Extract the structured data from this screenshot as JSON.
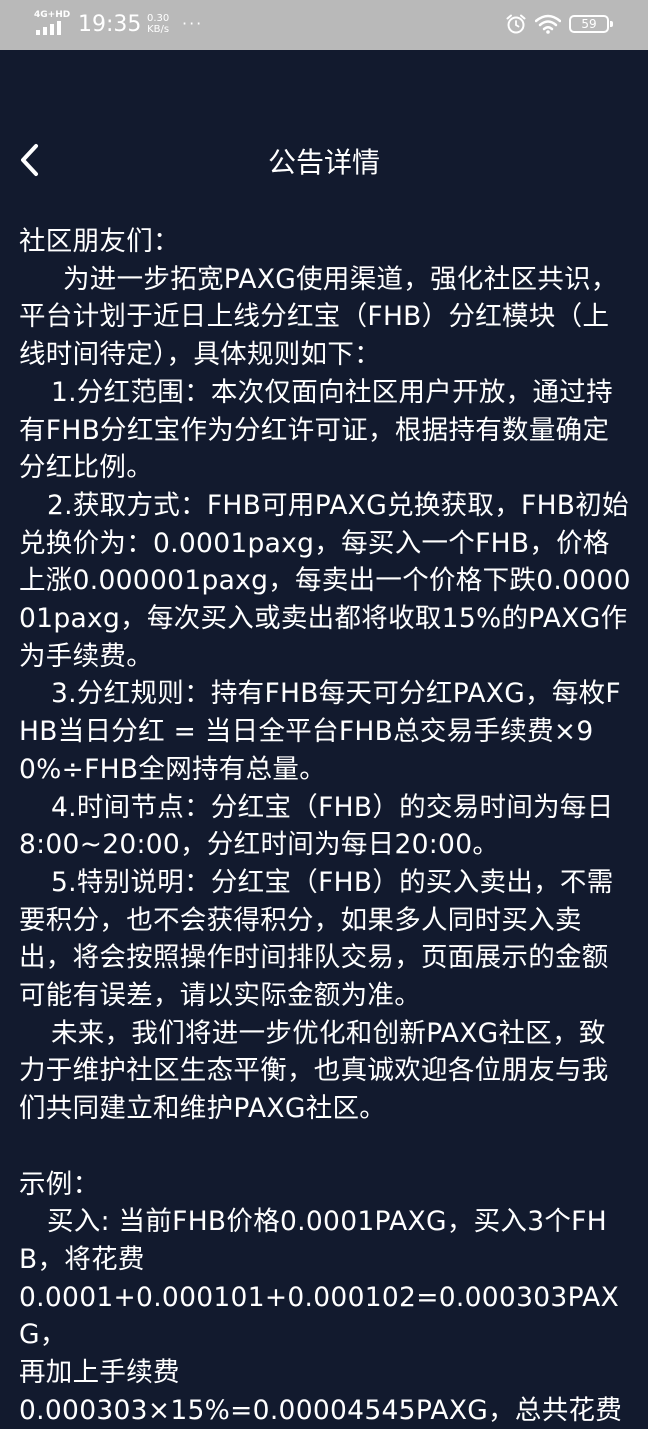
{
  "status_bar": {
    "network": "4G+HD",
    "time": "19:35",
    "speed_value": "0.30",
    "speed_unit": "KB/s",
    "dots": "···",
    "battery": "59"
  },
  "header": {
    "back_icon": "chevron-left-icon",
    "title": "公告详情"
  },
  "content": {
    "greeting": "社区朋友们：",
    "intro": "为进一步拓宽PAXG使用渠道，强化社区共识，平台计划于近日上线分红宝（FHB）分红模块（上线时间待定），具体规则如下：",
    "rule1": "1.分红范围：本次仅面向社区用户开放，通过持有FHB分红宝作为分红许可证，根据持有数量确定分红比例。",
    "rule2": "2.获取方式：FHB可用PAXG兑换获取，FHB初始兑换价为：0.0001paxg，每买入一个FHB，价格上涨0.000001paxg，每卖出一个价格下跌0.000001paxg，每次买入或卖出都将收取15%的PAXG作为手续费。",
    "rule3": "3.分红规则：持有FHB每天可分红PAXG，每枚FHB当日分红 = 当日全平台FHB总交易手续费×90%÷FHB全网持有总量。",
    "rule4": "4.时间节点：分红宝（FHB）的交易时间为每日8:00~20:00，分红时间为每日20:00。",
    "rule5": "5.特别说明：分红宝（FHB）的买入卖出，不需要积分，也不会获得积分，如果多人同时买入卖出，将会按照操作时间排队交易，页面展示的金额可能有误差，请以实际金额为准。",
    "future": "未来，我们将进一步优化和创新PAXG社区，致力于维护社区生态平衡，也真诚欢迎各位朋友与我们共同建立和维护PAXG社区。",
    "example_title": "示例：",
    "example_buy_1": "买入: 当前FHB价格0.0001PAXG，买入3个FHB，将花费",
    "example_buy_2": "0.0001+0.000101+0.000102=0.000303PAXG，",
    "example_buy_3": "再加上手续费",
    "example_buy_4": "0.000303×15%=0.00004545PAXG，总共花费"
  }
}
